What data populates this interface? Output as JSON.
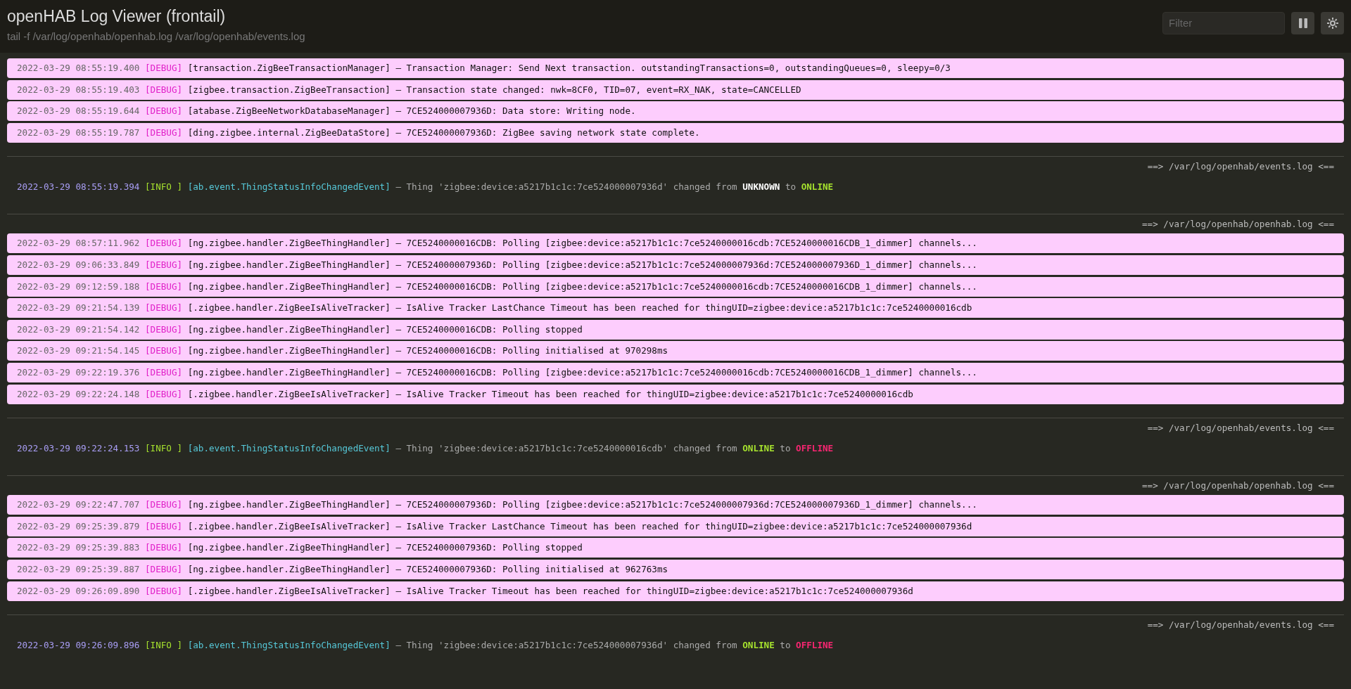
{
  "header": {
    "title": "openHAB Log Viewer (frontail)",
    "subtitle": "tail -f /var/log/openhab/openhab.log /var/log/openhab/events.log",
    "filter": {
      "placeholder": "Filter"
    }
  },
  "sections": [
    {
      "entries": [
        {
          "kind": "debug",
          "time": "2022-03-29 08:55:19.400",
          "level": "[DEBUG]",
          "logger": "[transaction.ZigBeeTransactionManager]",
          "message": "– Transaction Manager: Send Next transaction. outstandingTransactions=0, outstandingQueues=0, sleepy=0/3"
        },
        {
          "kind": "debug",
          "time": "2022-03-29 08:55:19.403",
          "level": "[DEBUG]",
          "logger": "[zigbee.transaction.ZigBeeTransaction]",
          "message": "– Transaction state changed: nwk=8CF0, TID=07, event=RX_NAK, state=CANCELLED"
        },
        {
          "kind": "debug",
          "time": "2022-03-29 08:55:19.644",
          "level": "[DEBUG]",
          "logger": "[atabase.ZigBeeNetworkDatabaseManager]",
          "message": "– 7CE524000007936D: Data store: Writing node."
        },
        {
          "kind": "debug",
          "time": "2022-03-29 08:55:19.787",
          "level": "[DEBUG]",
          "logger": "[ding.zigbee.internal.ZigBeeDataStore]",
          "message": "– 7CE524000007936D: ZigBee saving network state complete."
        }
      ]
    },
    {
      "file": "==> /var/log/openhab/events.log <==",
      "entries": [
        {
          "kind": "info",
          "time": "2022-03-29 08:55:19.394",
          "level": "[INFO ]",
          "logger": "[ab.event.ThingStatusInfoChangedEvent]",
          "message": "– Thing 'zigbee:device:a5217b1c1c:7ce524000007936d' changed from",
          "from": {
            "text": "UNKNOWN",
            "kind": "unknown"
          },
          "joiner": "to",
          "to": {
            "text": "ONLINE",
            "kind": "online"
          }
        }
      ]
    },
    {
      "file": "==> /var/log/openhab/openhab.log <==",
      "entries": [
        {
          "kind": "debug",
          "time": "2022-03-29 08:57:11.962",
          "level": "[DEBUG]",
          "logger": "[ng.zigbee.handler.ZigBeeThingHandler]",
          "message": "– 7CE5240000016CDB: Polling [zigbee:device:a5217b1c1c:7ce5240000016cdb:7CE5240000016CDB_1_dimmer] channels..."
        },
        {
          "kind": "debug",
          "time": "2022-03-29 09:06:33.849",
          "level": "[DEBUG]",
          "logger": "[ng.zigbee.handler.ZigBeeThingHandler]",
          "message": "– 7CE524000007936D: Polling [zigbee:device:a5217b1c1c:7ce524000007936d:7CE524000007936D_1_dimmer] channels..."
        },
        {
          "kind": "debug",
          "time": "2022-03-29 09:12:59.188",
          "level": "[DEBUG]",
          "logger": "[ng.zigbee.handler.ZigBeeThingHandler]",
          "message": "– 7CE5240000016CDB: Polling [zigbee:device:a5217b1c1c:7ce5240000016cdb:7CE5240000016CDB_1_dimmer] channels..."
        },
        {
          "kind": "debug",
          "time": "2022-03-29 09:21:54.139",
          "level": "[DEBUG]",
          "logger": "[.zigbee.handler.ZigBeeIsAliveTracker]",
          "message": "– IsAlive Tracker LastChance Timeout has been reached for thingUID=zigbee:device:a5217b1c1c:7ce5240000016cdb"
        },
        {
          "kind": "debug",
          "time": "2022-03-29 09:21:54.142",
          "level": "[DEBUG]",
          "logger": "[ng.zigbee.handler.ZigBeeThingHandler]",
          "message": "– 7CE5240000016CDB: Polling stopped"
        },
        {
          "kind": "debug",
          "time": "2022-03-29 09:21:54.145",
          "level": "[DEBUG]",
          "logger": "[ng.zigbee.handler.ZigBeeThingHandler]",
          "message": "– 7CE5240000016CDB: Polling initialised at 970298ms"
        },
        {
          "kind": "debug",
          "time": "2022-03-29 09:22:19.376",
          "level": "[DEBUG]",
          "logger": "[ng.zigbee.handler.ZigBeeThingHandler]",
          "message": "– 7CE5240000016CDB: Polling [zigbee:device:a5217b1c1c:7ce5240000016cdb:7CE5240000016CDB_1_dimmer] channels..."
        },
        {
          "kind": "debug",
          "time": "2022-03-29 09:22:24.148",
          "level": "[DEBUG]",
          "logger": "[.zigbee.handler.ZigBeeIsAliveTracker]",
          "message": "– IsAlive Tracker Timeout has been reached for thingUID=zigbee:device:a5217b1c1c:7ce5240000016cdb"
        }
      ]
    },
    {
      "file": "==> /var/log/openhab/events.log <==",
      "entries": [
        {
          "kind": "info",
          "time": "2022-03-29 09:22:24.153",
          "level": "[INFO ]",
          "logger": "[ab.event.ThingStatusInfoChangedEvent]",
          "message": "– Thing 'zigbee:device:a5217b1c1c:7ce5240000016cdb' changed from",
          "from": {
            "text": "ONLINE",
            "kind": "online"
          },
          "joiner": "to",
          "to": {
            "text": "OFFLINE",
            "kind": "offline"
          }
        }
      ]
    },
    {
      "file": "==> /var/log/openhab/openhab.log <==",
      "entries": [
        {
          "kind": "debug",
          "time": "2022-03-29 09:22:47.707",
          "level": "[DEBUG]",
          "logger": "[ng.zigbee.handler.ZigBeeThingHandler]",
          "message": "– 7CE524000007936D: Polling [zigbee:device:a5217b1c1c:7ce524000007936d:7CE524000007936D_1_dimmer] channels..."
        },
        {
          "kind": "debug",
          "time": "2022-03-29 09:25:39.879",
          "level": "[DEBUG]",
          "logger": "[.zigbee.handler.ZigBeeIsAliveTracker]",
          "message": "– IsAlive Tracker LastChance Timeout has been reached for thingUID=zigbee:device:a5217b1c1c:7ce524000007936d"
        },
        {
          "kind": "debug",
          "time": "2022-03-29 09:25:39.883",
          "level": "[DEBUG]",
          "logger": "[ng.zigbee.handler.ZigBeeThingHandler]",
          "message": "– 7CE524000007936D: Polling stopped"
        },
        {
          "kind": "debug",
          "time": "2022-03-29 09:25:39.887",
          "level": "[DEBUG]",
          "logger": "[ng.zigbee.handler.ZigBeeThingHandler]",
          "message": "– 7CE524000007936D: Polling initialised at 962763ms"
        },
        {
          "kind": "debug",
          "time": "2022-03-29 09:26:09.890",
          "level": "[DEBUG]",
          "logger": "[.zigbee.handler.ZigBeeIsAliveTracker]",
          "message": "– IsAlive Tracker Timeout has been reached for thingUID=zigbee:device:a5217b1c1c:7ce524000007936d"
        }
      ]
    },
    {
      "file": "==> /var/log/openhab/events.log <==",
      "entries": [
        {
          "kind": "info",
          "time": "2022-03-29 09:26:09.896",
          "level": "[INFO ]",
          "logger": "[ab.event.ThingStatusInfoChangedEvent]",
          "message": "– Thing 'zigbee:device:a5217b1c1c:7ce524000007936d' changed from",
          "from": {
            "text": "ONLINE",
            "kind": "online"
          },
          "joiner": "to",
          "to": {
            "text": "OFFLINE",
            "kind": "offline"
          }
        }
      ]
    }
  ]
}
